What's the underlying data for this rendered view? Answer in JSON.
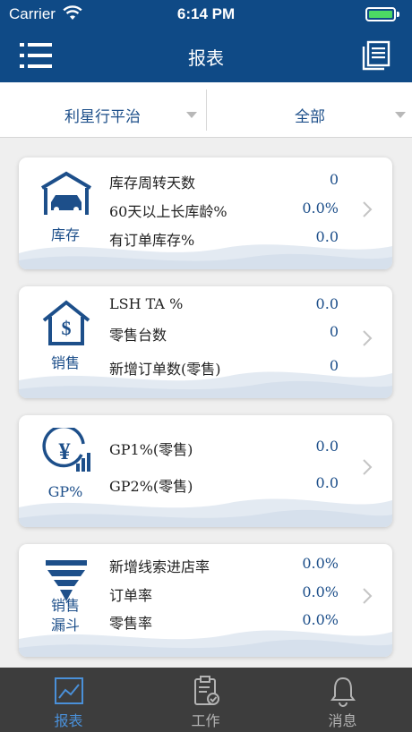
{
  "status_bar": {
    "carrier": "Carrier",
    "time": "6:14 PM"
  },
  "header": {
    "title": "报表",
    "menu_icon": "hamburger-list-icon",
    "right_icon": "document-stack-icon"
  },
  "filters": {
    "left": "利星行平治",
    "right": "全部"
  },
  "cards": [
    {
      "label": "库存",
      "icon": "garage-car-icon",
      "rows": [
        {
          "name": "库存周转天数",
          "value": "0"
        },
        {
          "name": "60天以上长库龄%",
          "value": "0.0%"
        },
        {
          "name": "有订单库存%",
          "value": "0.0"
        }
      ]
    },
    {
      "label": "销售",
      "icon": "house-dollar-icon",
      "rows": [
        {
          "name": "LSH TA %",
          "value": "0.0"
        },
        {
          "name": "零售台数",
          "value": "0"
        },
        {
          "name": "新增订单数(零售)",
          "value": "0"
        }
      ]
    },
    {
      "label": "GP%",
      "icon": "yen-chart-icon",
      "rows": [
        {
          "name": "GP1%(零售)",
          "value": "0.0"
        },
        {
          "name": "GP2%(零售)",
          "value": "0.0"
        }
      ]
    },
    {
      "label_line1": "销售",
      "label_line2": "漏斗",
      "icon": "funnel-icon",
      "rows": [
        {
          "name": "新增线索进店率",
          "value": "0.0%"
        },
        {
          "name": "订单率",
          "value": "0.0%"
        },
        {
          "name": "零售率",
          "value": "0.0%"
        }
      ]
    }
  ],
  "tabs": [
    {
      "label": "报表",
      "icon": "line-chart-icon",
      "active": true
    },
    {
      "label": "工作",
      "icon": "clipboard-check-icon",
      "active": false
    },
    {
      "label": "消息",
      "icon": "bell-icon",
      "active": false
    }
  ],
  "colors": {
    "primary": "#0f4a86",
    "accent_text": "#1d4f8a",
    "tab_active": "#4a90d9",
    "tab_bar": "#3d3d3d",
    "battery": "#4cd964"
  }
}
